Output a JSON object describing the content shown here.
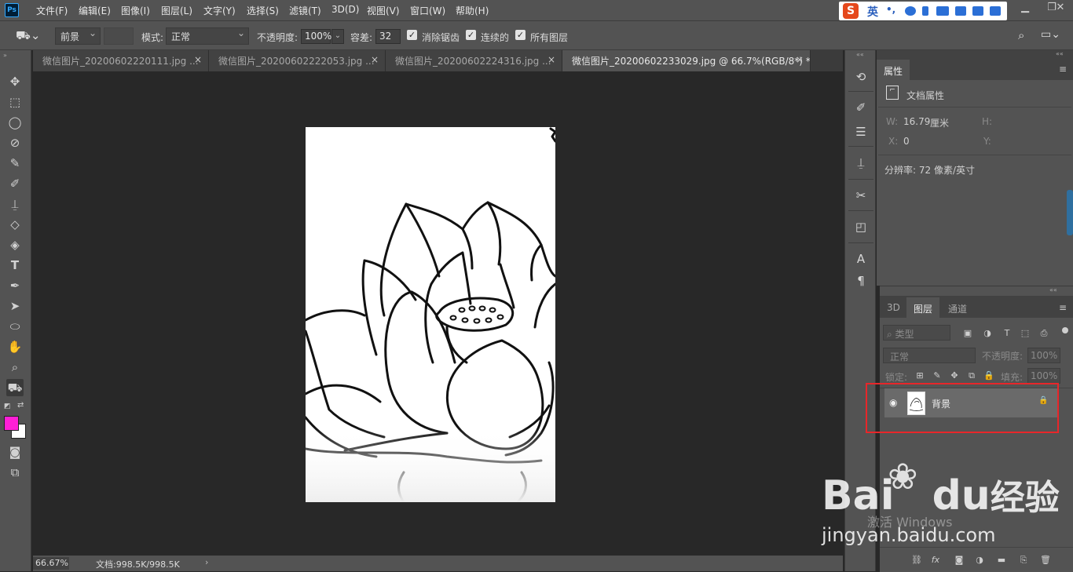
{
  "menubar": {
    "app_icon": "Ps",
    "items": [
      "文件(F)",
      "编辑(E)",
      "图像(I)",
      "图层(L)",
      "文字(Y)",
      "选择(S)",
      "滤镜(T)",
      "3D(D)",
      "视图(V)",
      "窗口(W)",
      "帮助(H)"
    ],
    "ime_lang": "英",
    "window_controls": [
      "minimize-icon",
      "restore-icon",
      "close-icon"
    ]
  },
  "options": {
    "fill_source": "前景",
    "mode_label": "模式:",
    "mode_value": "正常",
    "opacity_label": "不透明度:",
    "opacity_value": "100%",
    "tolerance_label": "容差:",
    "tolerance_value": "32",
    "antialias_label": "消除锯齿",
    "contiguous_label": "连续的",
    "all_layers_label": "所有图层"
  },
  "tabs": [
    {
      "label": "微信图片_20200602220111.jpg ...",
      "active": false
    },
    {
      "label": "微信图片_20200602222053.jpg ...",
      "active": false
    },
    {
      "label": "微信图片_20200602224316.jpg ...",
      "active": false
    },
    {
      "label": "微信图片_20200602233029.jpg @ 66.7%(RGB/8*) *",
      "active": true
    }
  ],
  "tab_close": "×",
  "colors": {
    "foreground": "#ff1fd6",
    "background": "#ffffff",
    "accent_red": "#e8262a"
  },
  "status": {
    "zoom": "66.67%",
    "doc": "文档:998.5K/998.5K",
    "arrow": "›"
  },
  "properties": {
    "title": "属性",
    "section": "文档属性",
    "w_label": "W:",
    "w_value": "16.79",
    "w_unit": "厘米",
    "h_label": "H:",
    "x_label": "X:",
    "x_value": "0",
    "y_label": "Y:",
    "resolution": "分辨率: 72 像素/英寸"
  },
  "layers_panel": {
    "tabs": [
      "3D",
      "图层",
      "通道"
    ],
    "filter_kind": "类型",
    "blend_mode": "正常",
    "opacity_label": "不透明度:",
    "opacity_value": "100%",
    "lock_label": "锁定:",
    "fill_label": "填充:",
    "fill_value": "100%",
    "layer_name": "背景"
  },
  "watermark": {
    "brand_left": "Bai",
    "brand_mid": "du",
    "brand_right": "经验",
    "url": "jingyan.baidu.com",
    "activate": "激活 Windows"
  }
}
